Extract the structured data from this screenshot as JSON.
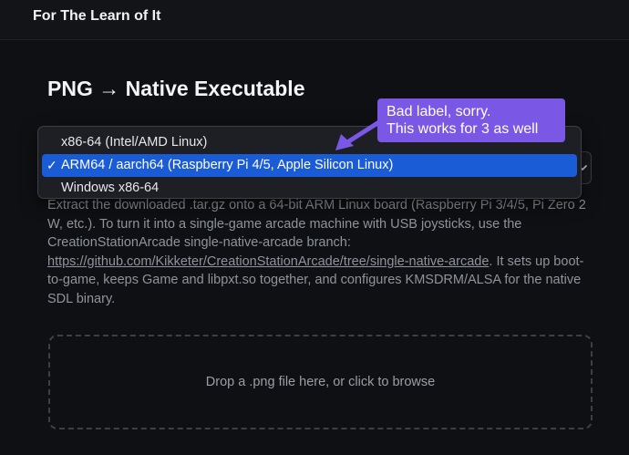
{
  "site": {
    "brand": "For The Learn of It"
  },
  "page": {
    "title": "PNG → Native Executable"
  },
  "target_select": {
    "options": [
      {
        "label": "x86-64 (Intel/AMD Linux)",
        "selected": false
      },
      {
        "label": "ARM64 / aarch64 (Raspberry Pi 4/5, Apple Silicon Linux)",
        "selected": true
      },
      {
        "label": "Windows x86-64",
        "selected": false
      }
    ],
    "check_glyph": "✓",
    "chevron_icon": "chevron-down-icon"
  },
  "annotation": {
    "line1": "Bad label, sorry.",
    "line2": "This works for 3 as well",
    "color": "#7b57e6"
  },
  "description": {
    "text_before": "Extract the downloaded .tar.gz onto a 64-bit ARM Linux board (Raspberry Pi 3/4/5, Pi Zero 2 W, etc.). To turn it into a single-game arcade machine with USB joysticks, use the CreationStationArcade single-native-arcade branch: ",
    "link": "https://github.com/Kikketer/CreationStationArcade/tree/single-native-arcade",
    "text_after": ". It sets up boot-to-game, keeps Game and libpxt.so together, and configures KMSDRM/ALSA for the native SDL binary."
  },
  "dropzone": {
    "label": "Drop a .png file here, or click to browse"
  },
  "colors": {
    "selected_option": "#1a5bd6",
    "background": "#0f1013"
  }
}
